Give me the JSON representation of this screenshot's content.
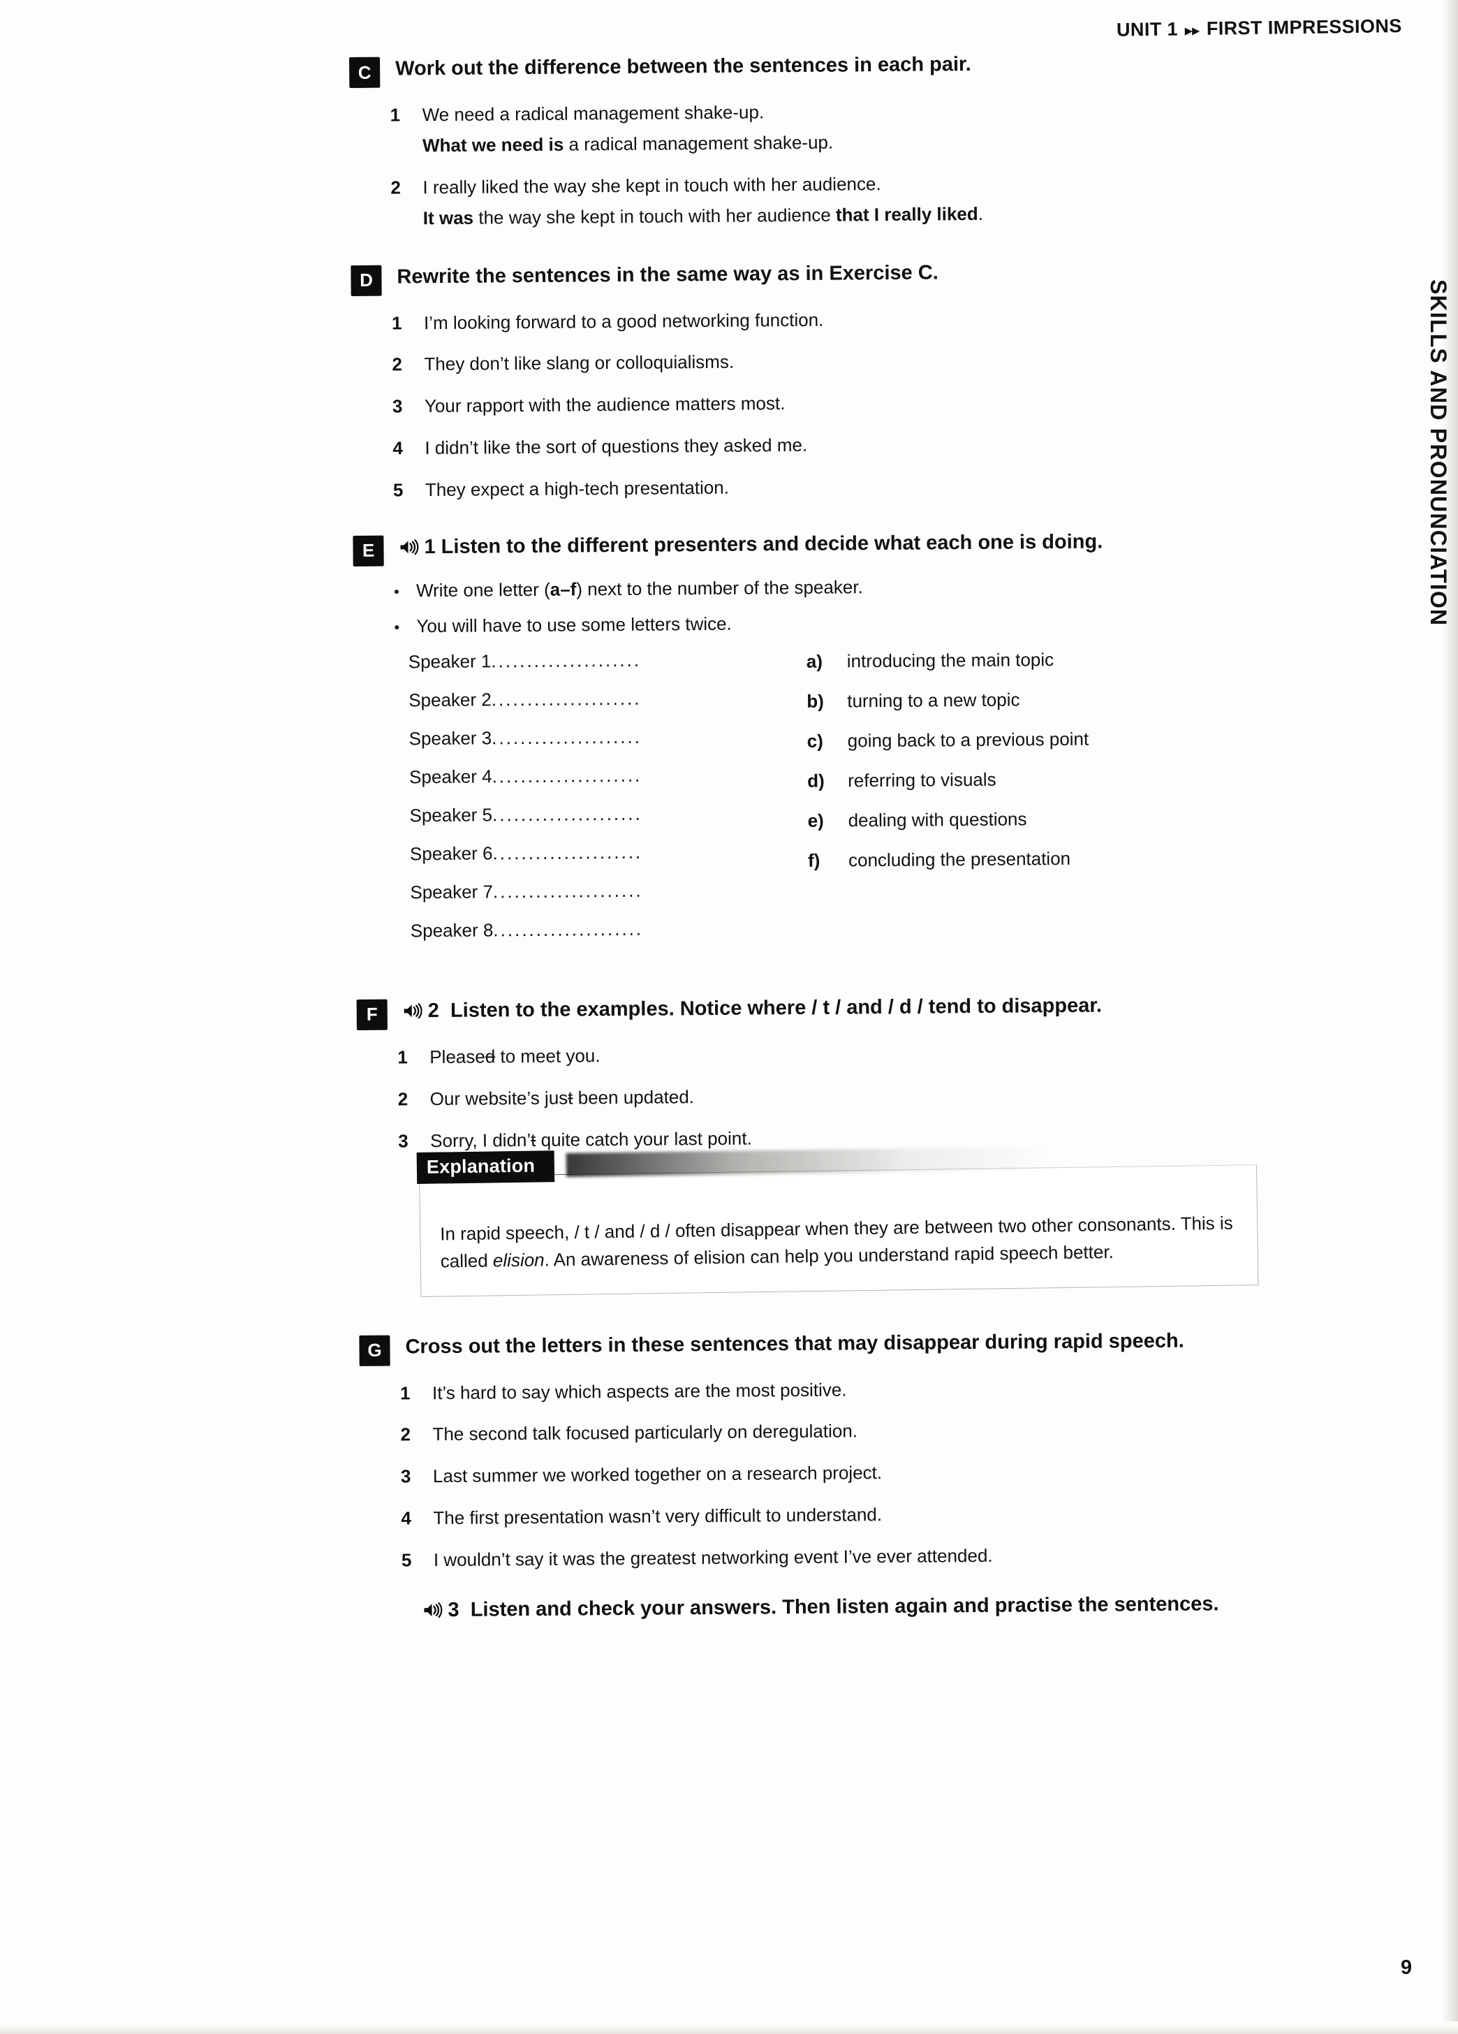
{
  "header": {
    "unit": "UNIT 1",
    "arrows": "▸▸",
    "title": "FIRST IMPRESSIONS"
  },
  "side_tab": "SKILLS AND PRONUNCIATION",
  "page_number": "9",
  "audio_icon": "speaker-icon",
  "exercises": [
    {
      "letter": "C",
      "title": "Work out the difference between the sentences in each pair.",
      "items": [
        {
          "num": "1",
          "line1": "We need a radical management shake-up.",
          "line2_bold": "What we need is",
          "line2_rest": " a radical management shake-up."
        },
        {
          "num": "2",
          "line1": "I really liked the way she kept in touch with her audience.",
          "line2_bold": "It was",
          "line2_mid": " the way she kept in touch with her audience ",
          "line2_bold2": "that I really liked",
          "line2_end": "."
        }
      ]
    },
    {
      "letter": "D",
      "title": "Rewrite the sentences in the same way as in Exercise C.",
      "items": [
        {
          "num": "1",
          "text": "I’m looking forward to a good networking function."
        },
        {
          "num": "2",
          "text": "They don’t like slang or colloquialisms."
        },
        {
          "num": "3",
          "text": "Your rapport with the audience matters most."
        },
        {
          "num": "4",
          "text": "I didn’t like the sort of questions they asked me."
        },
        {
          "num": "5",
          "text": "They expect a high-tech presentation."
        }
      ]
    },
    {
      "letter": "E",
      "track": "1",
      "title": "Listen to the different presenters and decide what each one is doing.",
      "bullets": [
        {
          "pre": "Write one letter (",
          "bold": "a–f",
          "post": ") next to the number of the speaker."
        },
        {
          "pre": "You will have to use some letters twice.",
          "bold": "",
          "post": ""
        }
      ],
      "speakers": [
        "Speaker 1",
        "Speaker 2",
        "Speaker 3",
        "Speaker 4",
        "Speaker 5",
        "Speaker 6",
        "Speaker 7",
        "Speaker 8"
      ],
      "leader": ".....................",
      "options": [
        {
          "key": "a)",
          "text": "introducing the main topic"
        },
        {
          "key": "b)",
          "text": "turning to a new topic"
        },
        {
          "key": "c)",
          "text": "going back to a previous point"
        },
        {
          "key": "d)",
          "text": "referring to visuals"
        },
        {
          "key": "e)",
          "text": "dealing with questions"
        },
        {
          "key": "f)",
          "text": "concluding the presentation"
        }
      ]
    },
    {
      "letter": "F",
      "track": "2",
      "title": "Listen to the examples. Notice where / t / and / d / tend to disappear.",
      "items": [
        {
          "num": "1",
          "pre": "Please",
          "strike": "d",
          "post": " to meet you."
        },
        {
          "num": "2",
          "pre": "Our website’s jus",
          "strike": "t",
          "post": " been updated."
        },
        {
          "num": "3",
          "pre": "Sorry, I didn’",
          "strike": "t",
          "post": " quite catch your last point."
        }
      ]
    },
    {
      "letter": "G",
      "title": "Cross out the letters in these sentences that may disappear during rapid speech.",
      "items": [
        {
          "num": "1",
          "text": "It’s hard to say which aspects are the most positive."
        },
        {
          "num": "2",
          "text": "The second talk focused particularly on deregulation."
        },
        {
          "num": "3",
          "text": "Last summer we worked together on a research project."
        },
        {
          "num": "4",
          "text": "The first presentation wasn’t very difficult to understand."
        },
        {
          "num": "5",
          "text": "I wouldn’t say it was the greatest networking event I’ve ever attended."
        }
      ]
    }
  ],
  "explanation": {
    "label": "Explanation",
    "body_part1": "In rapid speech, / t / and / d / often disappear when they are between two other consonants. This is called ",
    "body_italic": "elision",
    "body_part2": ". An awareness of elision can help you understand rapid speech better."
  },
  "final_audio": {
    "track": "3",
    "text": "Listen and check your answers. Then listen again and practise the sentences."
  }
}
